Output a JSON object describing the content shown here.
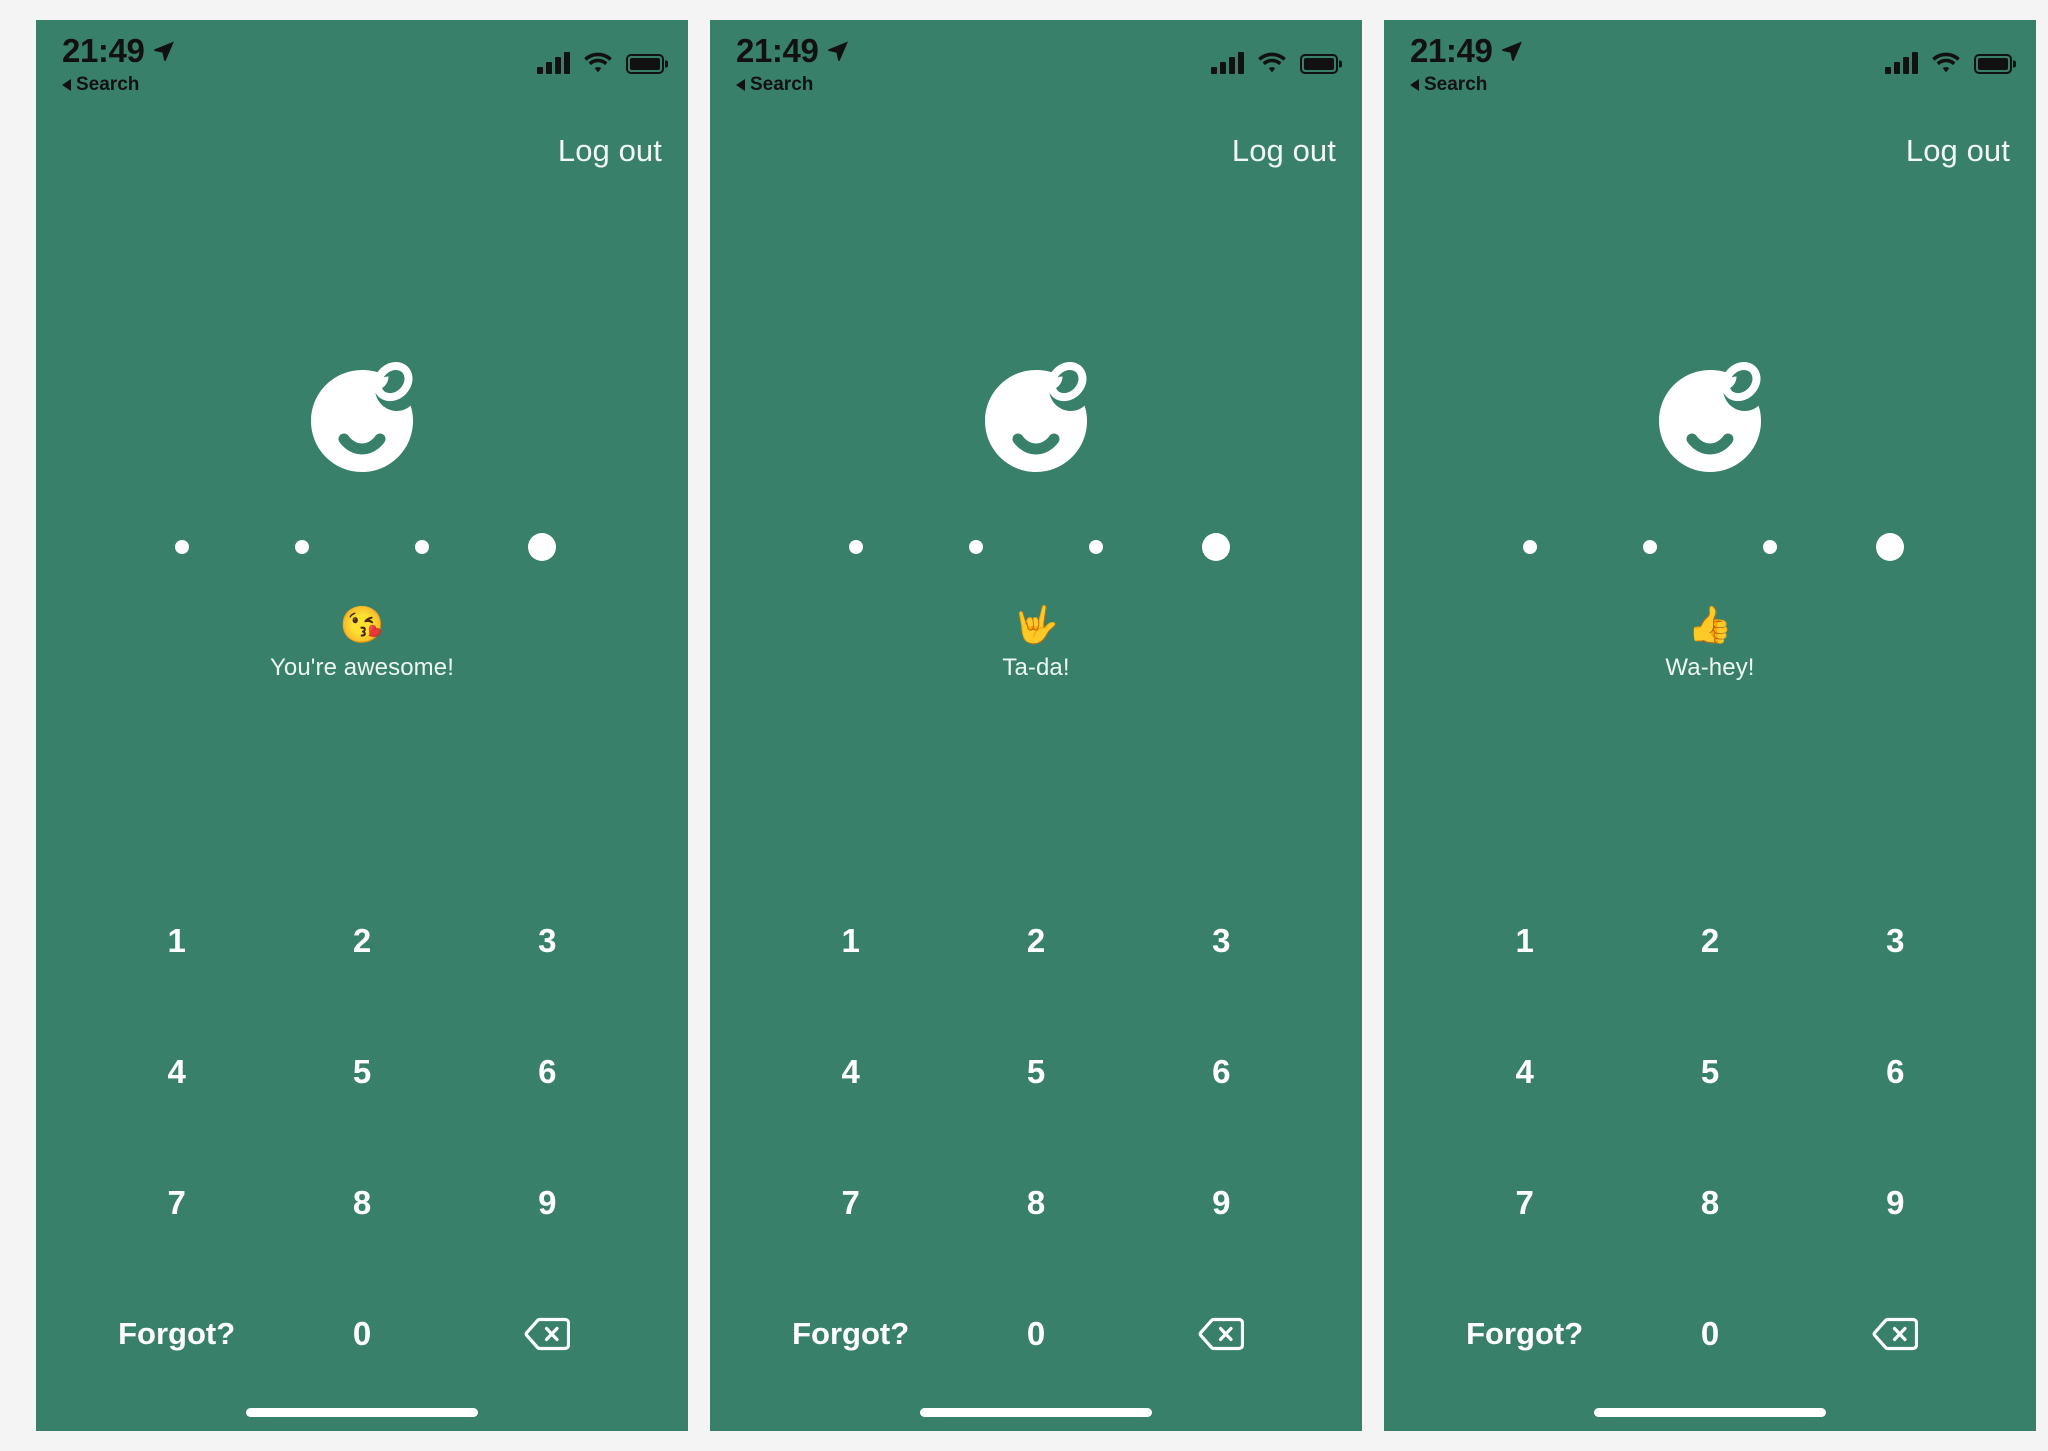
{
  "page": {
    "background_color": "#f4f4f4",
    "screen_background_color": "#38806A",
    "accent_text_color": "#ffffff"
  },
  "status_bar": {
    "time": "21:49",
    "location_arrow_icon": "location-arrow-icon",
    "back_label": "Search",
    "signal_icon": "cellular-signal-icon",
    "wifi_icon": "wifi-icon",
    "battery_icon": "battery-full-icon"
  },
  "header": {
    "logout_label": "Log out"
  },
  "logo": {
    "icon_name": "smiley-fruit-logo",
    "color": "#ffffff"
  },
  "pin": {
    "dots": [
      {
        "state": "filled",
        "size": "small"
      },
      {
        "state": "filled",
        "size": "small"
      },
      {
        "state": "filled",
        "size": "small"
      },
      {
        "state": "active",
        "size": "large"
      }
    ]
  },
  "keypad": {
    "keys": [
      {
        "name": "key-1",
        "label": "1",
        "type": "digit"
      },
      {
        "name": "key-2",
        "label": "2",
        "type": "digit"
      },
      {
        "name": "key-3",
        "label": "3",
        "type": "digit"
      },
      {
        "name": "key-4",
        "label": "4",
        "type": "digit"
      },
      {
        "name": "key-5",
        "label": "5",
        "type": "digit"
      },
      {
        "name": "key-6",
        "label": "6",
        "type": "digit"
      },
      {
        "name": "key-7",
        "label": "7",
        "type": "digit"
      },
      {
        "name": "key-8",
        "label": "8",
        "type": "digit"
      },
      {
        "name": "key-9",
        "label": "9",
        "type": "digit"
      },
      {
        "name": "key-forgot",
        "label": "Forgot?",
        "type": "action"
      },
      {
        "name": "key-0",
        "label": "0",
        "type": "digit"
      },
      {
        "name": "key-delete",
        "label": "",
        "type": "delete",
        "icon": "backspace-delete-icon"
      }
    ]
  },
  "screens": [
    {
      "id": "screen-1",
      "message": {
        "emoji": "😘",
        "emoji_name": "kissing-face-emoji",
        "text": "You're awesome!"
      }
    },
    {
      "id": "screen-2",
      "message": {
        "emoji": "🤟",
        "emoji_name": "love-you-gesture-emoji",
        "text": "Ta-da!"
      }
    },
    {
      "id": "screen-3",
      "message": {
        "emoji": "👍",
        "emoji_name": "thumbs-up-emoji",
        "text": "Wa-hey!"
      }
    }
  ]
}
